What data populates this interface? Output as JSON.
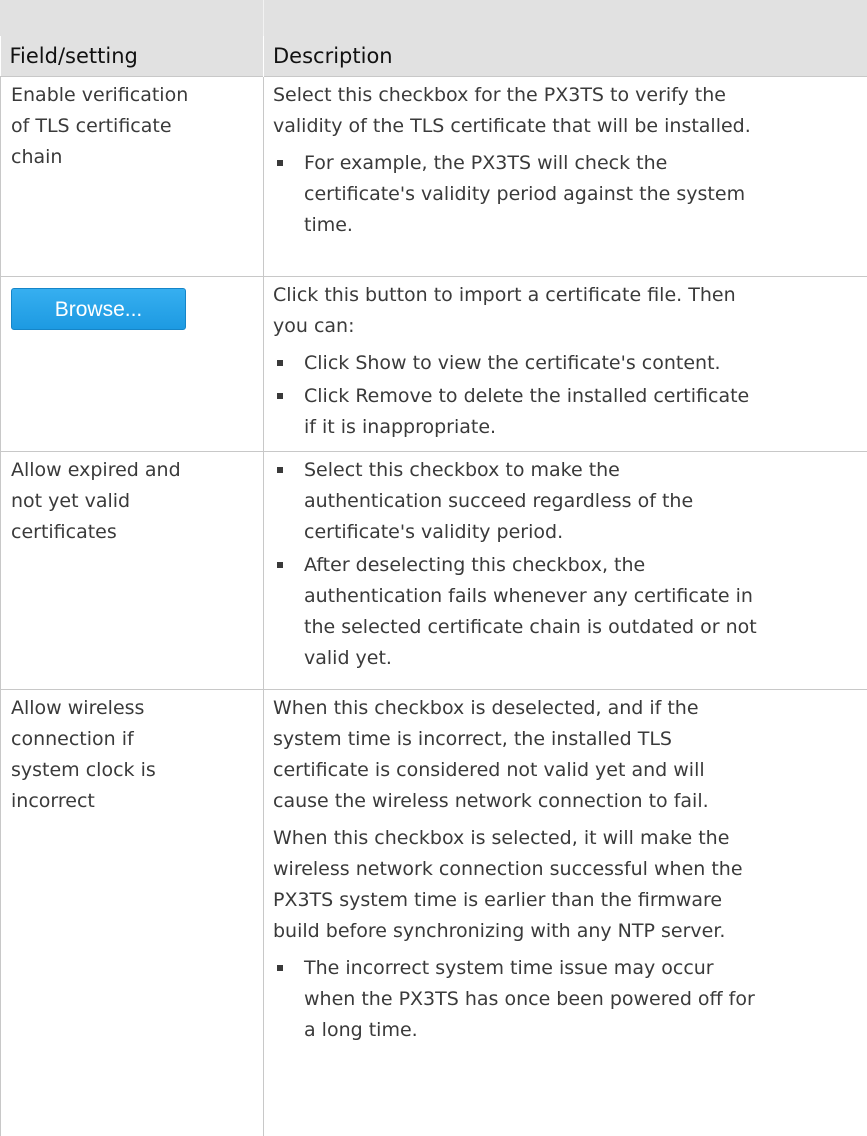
{
  "header": {
    "col1": "Field/setting",
    "col2": "Description"
  },
  "rows": [
    {
      "field_lines": [
        "Enable verification",
        "of TLS certificate",
        "chain"
      ],
      "paras": [
        "Select this checkbox for the PX3TS to verify the",
        "validity of the TLS certificate that will be installed."
      ],
      "bullets": [
        [
          "For example, the PX3TS will check the",
          "certificate's validity period against the system",
          "time."
        ]
      ]
    },
    {
      "button_label": "Browse...",
      "paras": [
        "Click this button to import a certificate file. Then",
        "you can:"
      ],
      "bullets": [
        [
          "Click Show to view the certificate's content."
        ],
        [
          "Click Remove to delete the installed certificate",
          "if it is inappropriate."
        ]
      ]
    },
    {
      "field_lines": [
        "Allow expired and",
        "not yet valid",
        "certificates"
      ],
      "bullets": [
        [
          "Select this checkbox to make the",
          "authentication succeed regardless of the",
          "certificate's validity period."
        ],
        [
          "After deselecting this checkbox, the",
          "authentication fails whenever any certificate in",
          "the selected certificate chain is outdated or not",
          "valid yet."
        ]
      ]
    },
    {
      "field_lines": [
        "Allow wireless",
        "connection if",
        "system clock is",
        "incorrect"
      ],
      "paras": [
        "When this checkbox is deselected, and if the",
        "system time is incorrect, the installed TLS",
        "certificate is considered not valid yet and will",
        "cause the wireless network connection to fail."
      ],
      "paras2": [
        "When this checkbox is selected, it will make the",
        "wireless network connection successful when the",
        "PX3TS system time is earlier than the firmware",
        "build before synchronizing with any NTP server."
      ],
      "bullets": [
        [
          "The incorrect system time issue may occur",
          "when the PX3TS has once been powered off for",
          "a long time."
        ]
      ]
    }
  ],
  "colors": {
    "header_bg": "#e1e1e1",
    "border": "#c8c8c8",
    "text": "#3a3a3a",
    "button_bg": "#1d9ae2"
  },
  "icons": [
    "square-bullet-icon"
  ]
}
